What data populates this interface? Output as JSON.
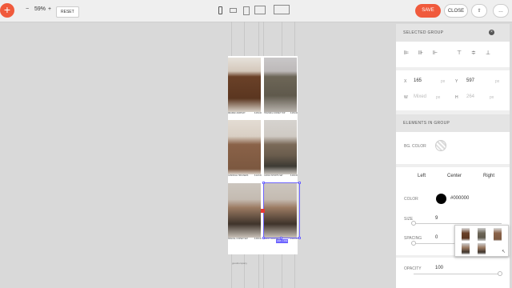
{
  "toolbar": {
    "zoom_minus": "−",
    "zoom_value": "59%",
    "zoom_plus": "+",
    "reset_label": "RESET",
    "save_label": "SAVE",
    "close_label": "CLOSE",
    "upload_label": "⇧",
    "more_label": "…",
    "add_label": "+"
  },
  "canvas": {
    "products": [
      {
        "name": "DRAPED JUMPSUIT",
        "price": "$ 450.00"
      },
      {
        "name": "TRAINING CORSET TOP",
        "price": "$ 250.00"
      },
      {
        "name": "CAMISOLE TROUSERS",
        "price": "$ 420.00"
      },
      {
        "name": "CARGO SHORTS SET",
        "price": "$ 290.00"
      },
      {
        "name": "SPECIAL CORSET SET",
        "price": "$ 380.00"
      },
      {
        "name": "WAIST TROUSERS",
        "price": "$ 320.00"
      }
    ],
    "selection_size": "168 × 264",
    "footer_text": "goodcompany"
  },
  "panel": {
    "selected_group_title": "SELECTED GROUP",
    "x_label": "X",
    "x_value": "165",
    "y_label": "Y",
    "y_value": "597",
    "unit_px": "px",
    "w_label": "W",
    "w_value": "Mixed",
    "h_label": "H",
    "h_value": "264",
    "elements_title": "ELEMENTS IN GROUP",
    "bg_color_label": "BG. COLOR",
    "align_left": "Left",
    "align_center": "Center",
    "align_right": "Right",
    "color_label": "COLOR",
    "color_value": "#000000",
    "size_label": "SIZE",
    "size_value": "9",
    "spacing_label": "SPACING",
    "spacing_value": "0",
    "opacity_label": "OPACITY",
    "opacity_value": "100"
  },
  "colors": {
    "accent": "#f05a3c",
    "selection": "#6c63ff",
    "text_color": "#000000"
  }
}
